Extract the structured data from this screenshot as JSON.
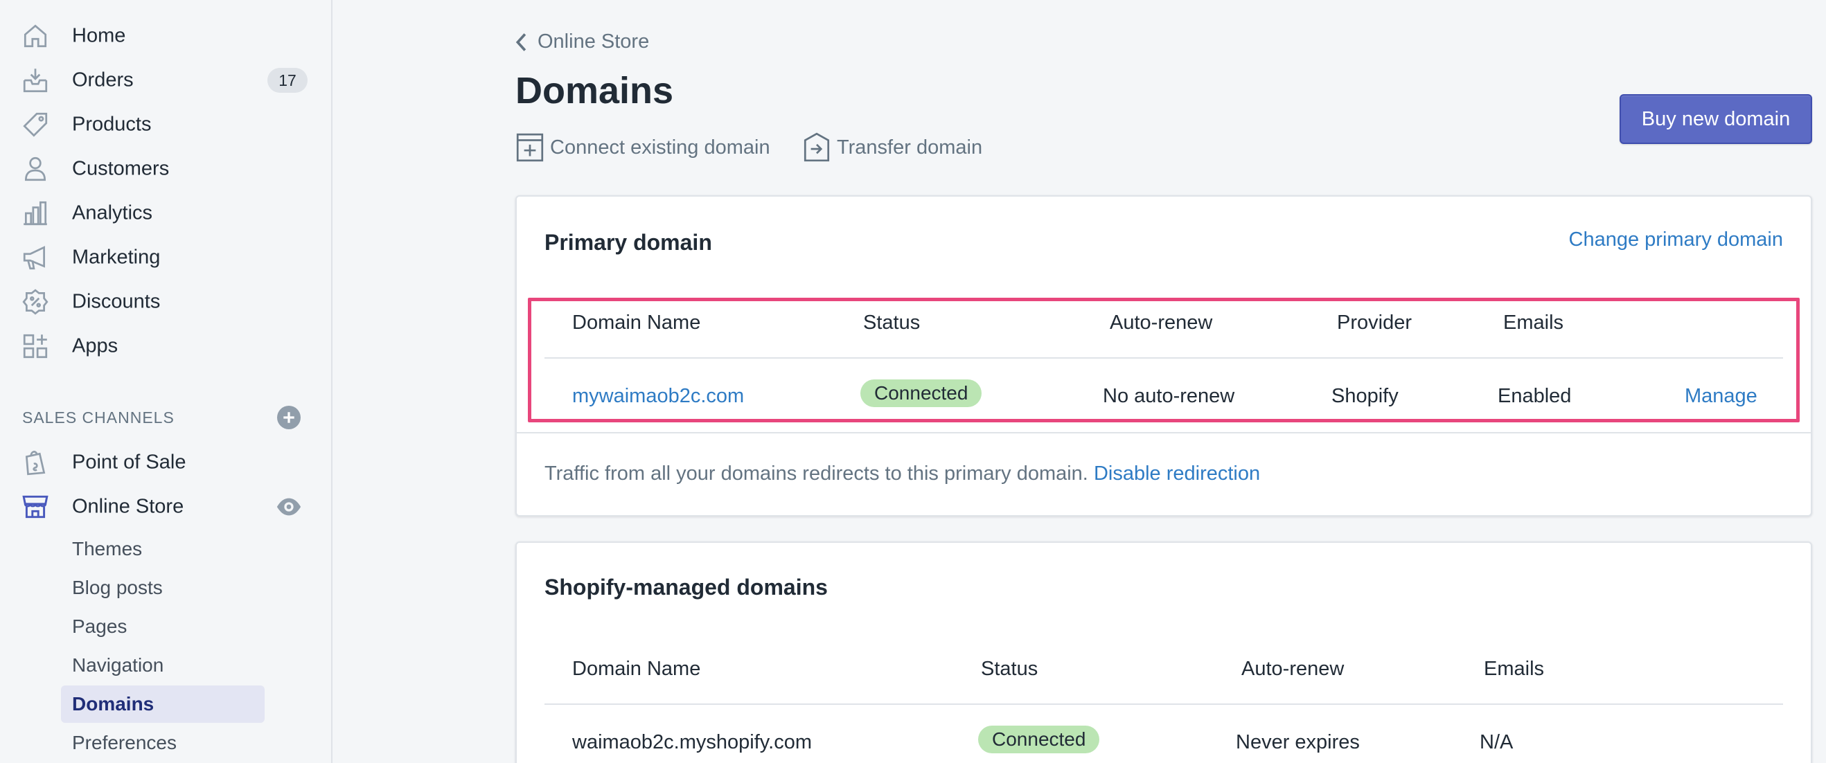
{
  "sidebar": {
    "items": [
      {
        "label": "Home",
        "icon": "home-icon"
      },
      {
        "label": "Orders",
        "icon": "orders-icon",
        "badge": "17"
      },
      {
        "label": "Products",
        "icon": "tag-icon"
      },
      {
        "label": "Customers",
        "icon": "person-icon"
      },
      {
        "label": "Analytics",
        "icon": "bar-chart-icon"
      },
      {
        "label": "Marketing",
        "icon": "megaphone-icon"
      },
      {
        "label": "Discounts",
        "icon": "discount-icon"
      },
      {
        "label": "Apps",
        "icon": "apps-icon"
      }
    ],
    "section_title": "SALES CHANNELS",
    "channels": [
      {
        "label": "Point of Sale",
        "icon": "shopping-bag-icon"
      },
      {
        "label": "Online Store",
        "icon": "store-icon"
      }
    ],
    "sub_items": [
      "Themes",
      "Blog posts",
      "Pages",
      "Navigation",
      "Domains",
      "Preferences"
    ],
    "active_sub_item": "Domains"
  },
  "header": {
    "back_label": "Online Store",
    "title": "Domains",
    "actions": {
      "connect": "Connect existing domain",
      "transfer": "Transfer domain"
    },
    "buy_button": "Buy new domain"
  },
  "primary_domain": {
    "title": "Primary domain",
    "change_link": "Change primary domain",
    "columns": [
      "Domain Name",
      "Status",
      "Auto-renew",
      "Provider",
      "Emails"
    ],
    "row": {
      "domain": "mywaimaob2c.com",
      "status": "Connected",
      "auto_renew": "No auto-renew",
      "provider": "Shopify",
      "emails": "Enabled",
      "action": "Manage"
    },
    "footer_text": "Traffic from all your domains redirects to this primary domain.",
    "footer_link": "Disable redirection"
  },
  "managed_domains": {
    "title": "Shopify-managed domains",
    "columns": [
      "Domain Name",
      "Status",
      "Auto-renew",
      "Emails"
    ],
    "row": {
      "domain": "waimaob2c.myshopify.com",
      "status": "Connected",
      "auto_renew": "Never expires",
      "emails": "N/A"
    }
  },
  "colors": {
    "accent": "#5c6ac4",
    "link": "#2e7bc4",
    "success_badge": "#bbe5b3",
    "highlight": "#e8467c"
  }
}
